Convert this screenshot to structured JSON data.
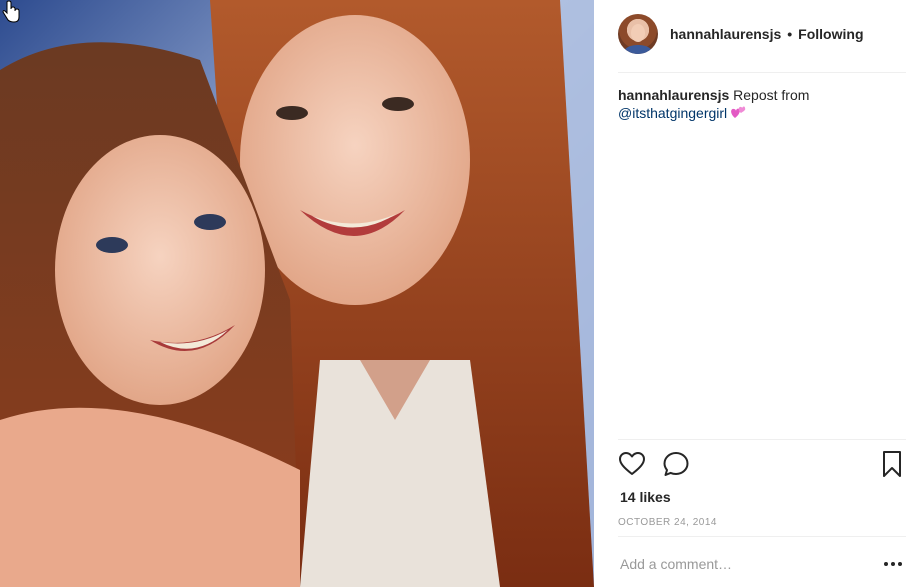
{
  "post": {
    "username": "hannahlaurensjs",
    "separator": "•",
    "follow_status": "Following",
    "caption": {
      "username": "hannahlaurensjs",
      "text": "Repost from",
      "mention": "@itsthatgingergirl",
      "emoji": "two-hearts-emoji"
    },
    "likes": "14 likes",
    "date": "OCTOBER 24, 2014",
    "comment_placeholder": "Add a comment…"
  },
  "icons": {
    "like": "heart-outline-icon",
    "comment": "speech-bubble-icon",
    "save": "bookmark-icon",
    "more": "ellipsis-icon"
  },
  "colors": {
    "text": "#262626",
    "mention": "#003569",
    "muted": "#999999",
    "divider": "#efefef"
  }
}
